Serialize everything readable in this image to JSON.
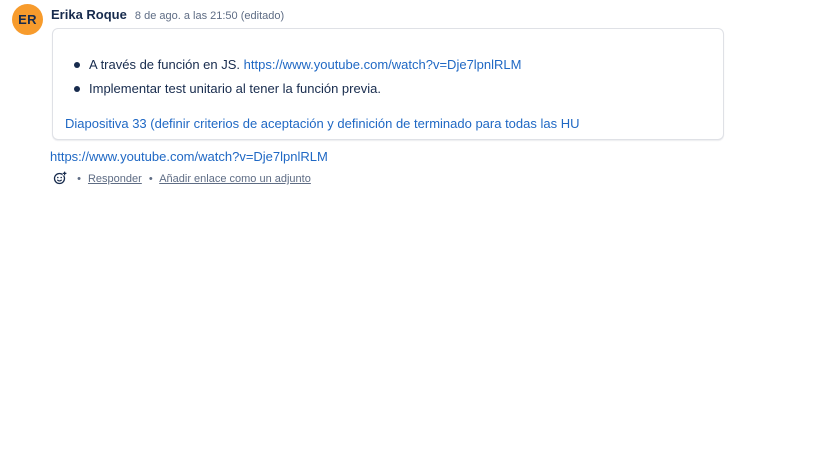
{
  "comment": {
    "avatar_initials": "ER",
    "avatar_color": "#f79b2c",
    "author": "Erika Roque",
    "timestamp": "8 de ago. a las 21:50 (editado)",
    "bullets": [
      {
        "text": "A través de función en JS. ",
        "link": "https://www.youtube.com/watch?v=Dje7lpnlRLM"
      },
      {
        "text": "Implementar test unitario al tener la función previa.",
        "link": ""
      }
    ],
    "card_link": "Diapositiva 33 (definir criterios de aceptación y definición de terminado para todas las HU",
    "attachment_link": "https://www.youtube.com/watch?v=Dje7lpnlRLM",
    "actions": {
      "reaction_icon": "add-reaction-icon",
      "separator": "•",
      "reply_label": "Responder",
      "add_link_label": "Añadir enlace como un adjunto"
    }
  },
  "colors": {
    "link": "#1f68c4",
    "text": "#172b4d",
    "muted": "#5e6c84",
    "border": "#dfe1e6"
  }
}
